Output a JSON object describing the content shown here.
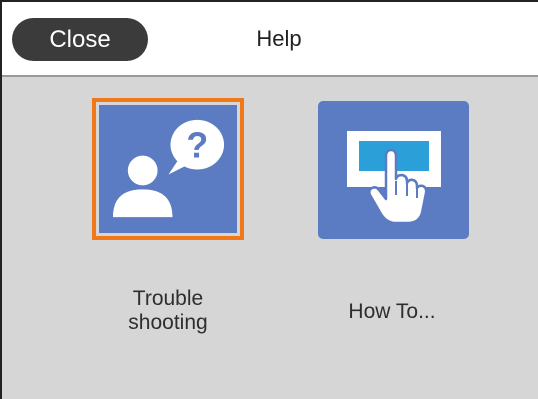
{
  "header": {
    "close_label": "Close",
    "title": "Help"
  },
  "tiles": [
    {
      "label_line1": "Trouble",
      "label_line2": "shooting",
      "icon": "person-question-icon",
      "selected": true
    },
    {
      "label": "How To...",
      "icon": "hand-touch-screen-icon",
      "selected": false
    }
  ],
  "colors": {
    "tile_blue": "#5b7bc3",
    "selection_orange": "#f07818",
    "close_button": "#3b3b3b",
    "background": "#d6d6d6"
  }
}
